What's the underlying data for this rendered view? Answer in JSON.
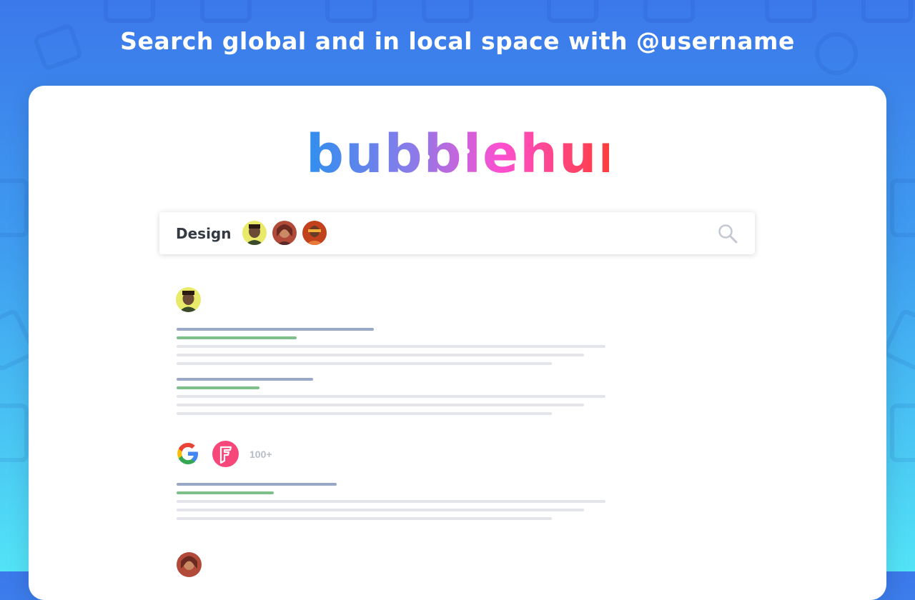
{
  "headline": "Search global and in local space with @username",
  "logo": {
    "text": "bubblehunt",
    "gradient": [
      "#2f8fef",
      "#8a7bea",
      "#ff4fcf",
      "#ff3d3d"
    ]
  },
  "search": {
    "query": "Design",
    "avatar_chips": [
      "avatar-1",
      "avatar-2",
      "avatar-3"
    ],
    "icon": "search-icon"
  },
  "results": {
    "sources": [
      "google-icon",
      "foursquare-icon"
    ],
    "count_label": "100+"
  },
  "colors": {
    "bg_top": "#3b78ea",
    "bg_bottom": "#52e3f6",
    "title_line": "#9aa8c7",
    "subtitle_line": "#7fbf8a",
    "text_line": "#e3e5ea",
    "foursquare": "#f74679"
  }
}
